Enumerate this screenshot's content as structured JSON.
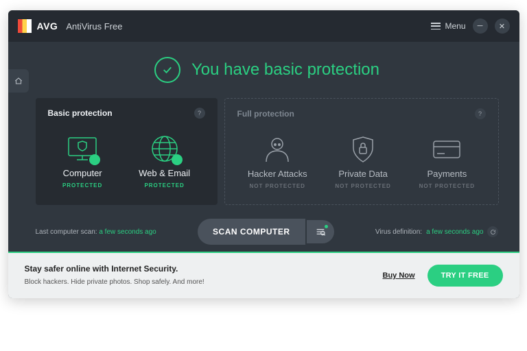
{
  "title": {
    "brand": "AVG",
    "product": "AntiVirus Free",
    "menu": "Menu"
  },
  "status": {
    "headline": "You have basic protection"
  },
  "panels": {
    "basic": {
      "title": "Basic protection",
      "tiles": [
        {
          "label": "Computer",
          "status": "PROTECTED"
        },
        {
          "label": "Web & Email",
          "status": "PROTECTED"
        }
      ]
    },
    "full": {
      "title": "Full protection",
      "tiles": [
        {
          "label": "Hacker Attacks",
          "status": "NOT PROTECTED"
        },
        {
          "label": "Private Data",
          "status": "NOT PROTECTED"
        },
        {
          "label": "Payments",
          "status": "NOT PROTECTED"
        }
      ]
    }
  },
  "scan": {
    "last_label": "Last computer scan:",
    "last_value": "a few seconds ago",
    "button": "SCAN COMPUTER",
    "def_label": "Virus definition:",
    "def_value": "a few seconds ago"
  },
  "promo": {
    "headline": "Stay safer online with Internet Security.",
    "sub": "Block hackers. Hide private photos. Shop safely. And more!",
    "buy": "Buy Now",
    "try": "TRY IT FREE"
  }
}
